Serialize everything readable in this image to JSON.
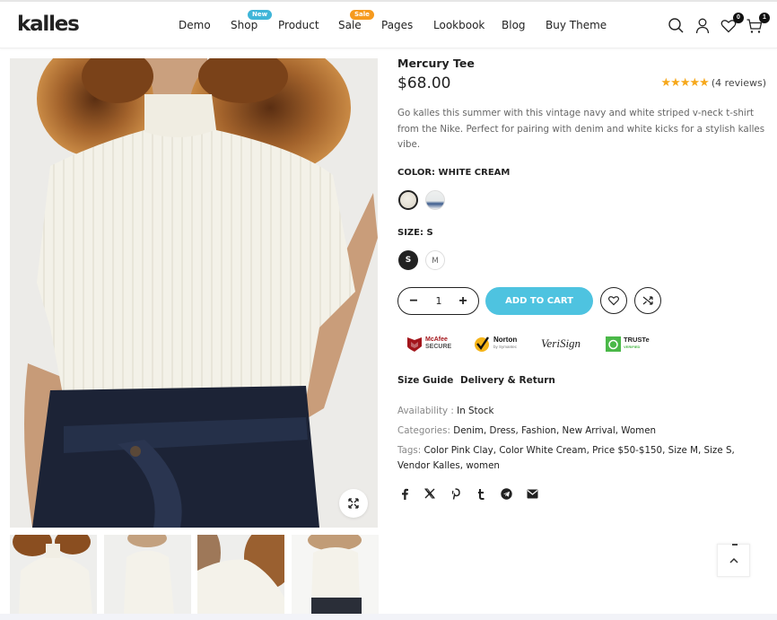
{
  "header": {
    "logo": "kalles",
    "nav": [
      {
        "label": "Demo",
        "badge": null
      },
      {
        "label": "Shop",
        "badge": "New"
      },
      {
        "label": "Product",
        "badge": null
      },
      {
        "label": "Sale",
        "badge": "Sale"
      },
      {
        "label": "Pages",
        "badge": null
      },
      {
        "label": "Lookbook",
        "badge": null
      },
      {
        "label": "Blog",
        "badge": null
      },
      {
        "label": "Buy Theme",
        "badge": null
      }
    ],
    "icons": {
      "search": "search-icon",
      "account": "user-icon",
      "wishlist": "heart-icon",
      "cart": "cart-icon"
    },
    "wishlist_count": "0",
    "cart_count": "1",
    "badge_colors": {
      "new": "#3fb5d8",
      "sale": "#f69a1d"
    }
  },
  "gallery": {
    "main_image_alt": "Woman wearing white cream ribbed mock-neck tee with dark denim",
    "zoom_icon": "expand-icon",
    "thumbnails": [
      {
        "alt": "Front view with hand on hip"
      },
      {
        "alt": "Side view"
      },
      {
        "alt": "Close-up shoulder view"
      },
      {
        "alt": "Full front view"
      }
    ]
  },
  "product": {
    "title": "Mercury Tee",
    "price": "$68.00",
    "rating": 5,
    "rating_max": 5,
    "stars": "★★★★★",
    "reviews": "(4 reviews)",
    "description": "Go kalles this summer with this vintage navy and white striped v-neck t-shirt from the Nike. Perfect for pairing with denim and white kicks for a stylish kalles vibe.",
    "color_label": "COLOR:",
    "color_value": "WHITE CREAM",
    "colors": [
      {
        "name": "White Cream",
        "selected": true
      },
      {
        "name": "Pink Clay",
        "selected": false
      }
    ],
    "size_label": "SIZE:",
    "size_value": "S",
    "sizes": [
      {
        "label": "S",
        "selected": true
      },
      {
        "label": "M",
        "selected": false
      }
    ],
    "quantity": "1",
    "qty_minus": "−",
    "qty_plus": "+",
    "add_to_cart": "ADD TO CART",
    "accent_color": "#4ec3e0",
    "star_color": "#f6a81c"
  },
  "trust_badges": [
    {
      "name": "McAfee",
      "line1": "McAfee",
      "line2": "SECURE"
    },
    {
      "name": "Norton",
      "line1": "Norton",
      "line2": "by Symantec"
    },
    {
      "name": "VeriSign",
      "line1": "VeriSign"
    },
    {
      "name": "TRUSTe",
      "line1": "TRUSTe",
      "line2": "VERIFIED"
    }
  ],
  "links": {
    "size_guide": "Size Guide",
    "delivery_return": "Delivery & Return"
  },
  "meta": {
    "availability_label": "Availability :",
    "availability_value": "In Stock",
    "categories_label": "Categories:",
    "categories": [
      "Denim",
      "Dress",
      "Fashion",
      "New Arrival",
      "Women"
    ],
    "tags_label": "Tags:",
    "tags": [
      "Color Pink Clay",
      "Color White Cream",
      "Price $50-$150",
      "Size M",
      "Size S",
      "Vendor Kalles",
      "women"
    ]
  },
  "share": [
    "facebook-icon",
    "x-twitter-icon",
    "pinterest-icon",
    "tumblr-icon",
    "telegram-icon",
    "email-icon"
  ],
  "back_to_top": "chevron-up-icon"
}
